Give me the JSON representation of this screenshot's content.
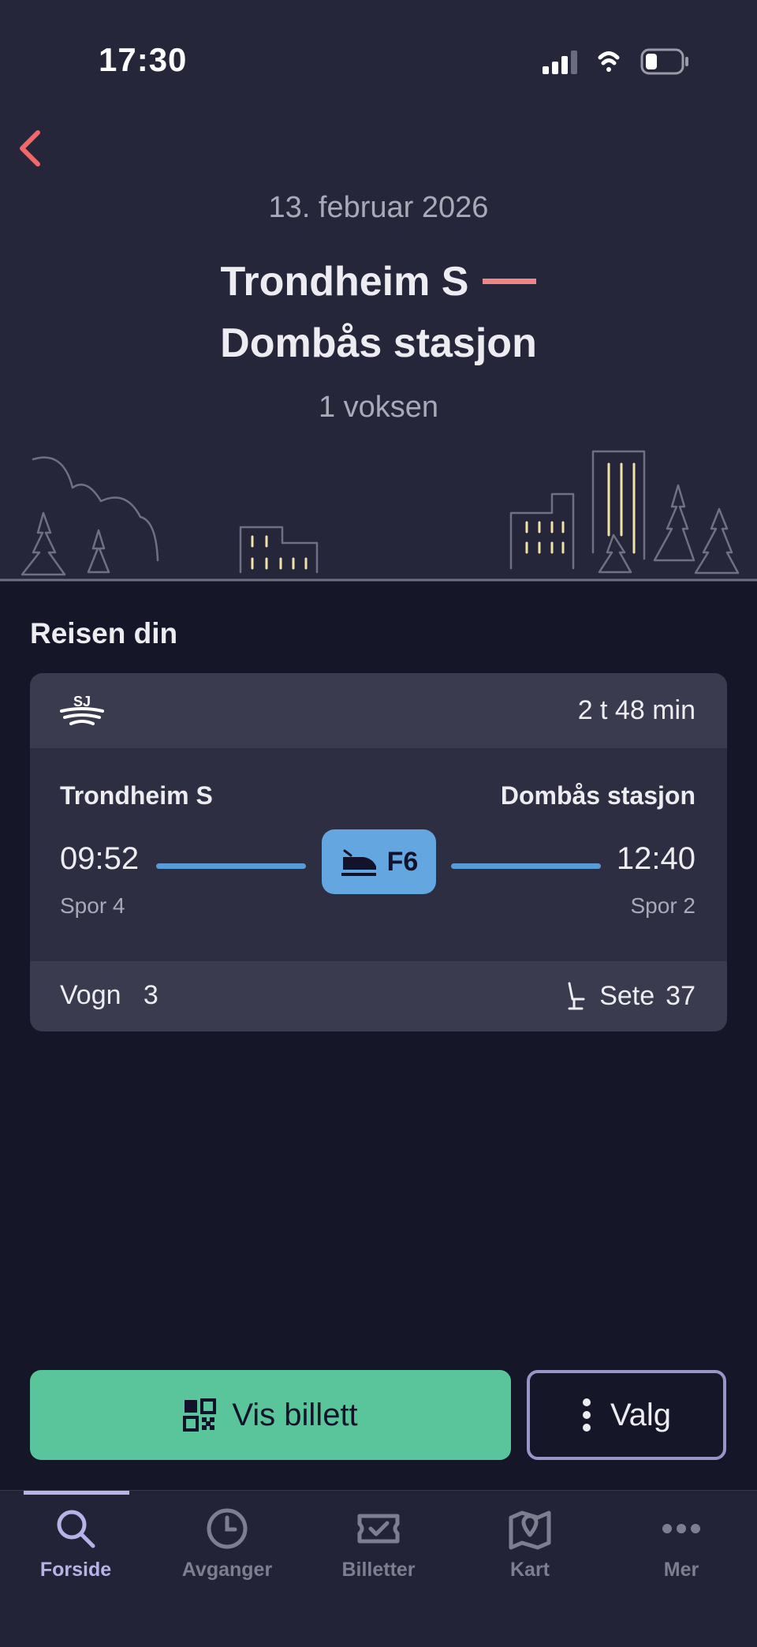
{
  "status_bar": {
    "time": "17:30",
    "icons": [
      "signal-icon",
      "wifi-icon",
      "battery-icon"
    ]
  },
  "header": {
    "back_icon": "chevron-left-icon",
    "date": "13. februar 2026",
    "from": "Trondheim S",
    "to": "Dombås stasjon",
    "passengers": "1 voksen"
  },
  "journey": {
    "section_title": "Reisen din",
    "operator_logo": "sj-logo",
    "duration": "2 t 48 min",
    "from_station": "Trondheim S",
    "to_station": "Dombås stasjon",
    "departure_time": "09:52",
    "arrival_time": "12:40",
    "train_icon": "train-icon",
    "train_line": "F6",
    "departure_track": "Spor 4",
    "arrival_track": "Spor 2",
    "wagon_label": "Vogn",
    "wagon_number": "3",
    "seat_icon": "seat-icon",
    "seat_label": "Sete",
    "seat_number": "37"
  },
  "actions": {
    "primary_label": "Vis billett",
    "primary_icon": "qr-code-icon",
    "secondary_label": "Valg",
    "secondary_icon": "more-vertical-icon"
  },
  "tabbar": {
    "active_index": 0,
    "items": [
      {
        "label": "Forside",
        "icon": "search-icon"
      },
      {
        "label": "Avganger",
        "icon": "clock-icon"
      },
      {
        "label": "Billetter",
        "icon": "ticket-icon"
      },
      {
        "label": "Kart",
        "icon": "map-icon"
      },
      {
        "label": "Mer",
        "icon": "more-horizontal-icon"
      }
    ]
  },
  "colors": {
    "background": "#151628",
    "header_bg": "#26263a",
    "accent_red": "#f08585",
    "train_blue": "#63a6e0",
    "primary_green": "#5ac49a",
    "tab_active": "#b6b3e6",
    "window_light": "#f3e3a6"
  }
}
